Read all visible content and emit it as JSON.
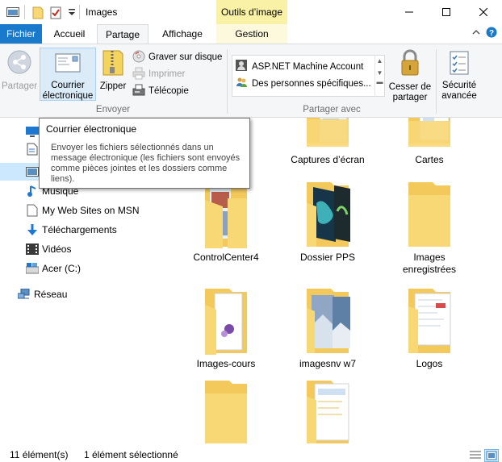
{
  "window": {
    "title": "Images",
    "context_tab_header": "Outils d’image"
  },
  "tabs": {
    "file": "Fichier",
    "home": "Accueil",
    "share": "Partage",
    "view": "Affichage",
    "manage": "Gestion"
  },
  "ribbon": {
    "share_label": "Partager",
    "email_label": "Courrier électronique",
    "zip_label": "Zipper",
    "burn_label": "Graver sur disque",
    "print_label": "Imprimer",
    "fax_label": "Télécopie",
    "send_group": "Envoyer",
    "share_with": [
      "ASP.NET Machine Account",
      "Des personnes spécifiques..."
    ],
    "share_with_group": "Partager avec",
    "stop_sharing_label": "Cesser de partager",
    "advanced_security_label": "Sécurité avancée"
  },
  "tooltip": {
    "title": "Courrier électronique",
    "body": "Envoyer les fichiers sélectionnés dans un message électronique (les fichiers sont envoyés comme pièces jointes et les dossiers comme liens)."
  },
  "nav": {
    "items": [
      {
        "label": "Musique",
        "icon": "music-icon"
      },
      {
        "label": "My Web Sites on MSN",
        "icon": "document-icon"
      },
      {
        "label": "Téléchargements",
        "icon": "download-icon"
      },
      {
        "label": "Vidéos",
        "icon": "video-icon"
      },
      {
        "label": "Acer (C:)",
        "icon": "drive-icon"
      },
      {
        "label": "Réseau",
        "icon": "network-icon"
      }
    ]
  },
  "content": {
    "partial_label": "s",
    "folders": [
      {
        "name": "Captures d’écran"
      },
      {
        "name": "Cartes"
      },
      {
        "name": "ControlCenter4"
      },
      {
        "name": "Dossier PPS"
      },
      {
        "name": "Images enregistrées"
      },
      {
        "name": "Images-cours"
      },
      {
        "name": "imagesnv w7"
      },
      {
        "name": "Logos"
      }
    ]
  },
  "status": {
    "count": "11 élément(s)",
    "selection": "1 élément sélectionné"
  },
  "colors": {
    "file_tab": "#1979ca",
    "context_tab": "#f9f2a6",
    "selection": "#cce8ff",
    "folder": "#f8d775"
  }
}
